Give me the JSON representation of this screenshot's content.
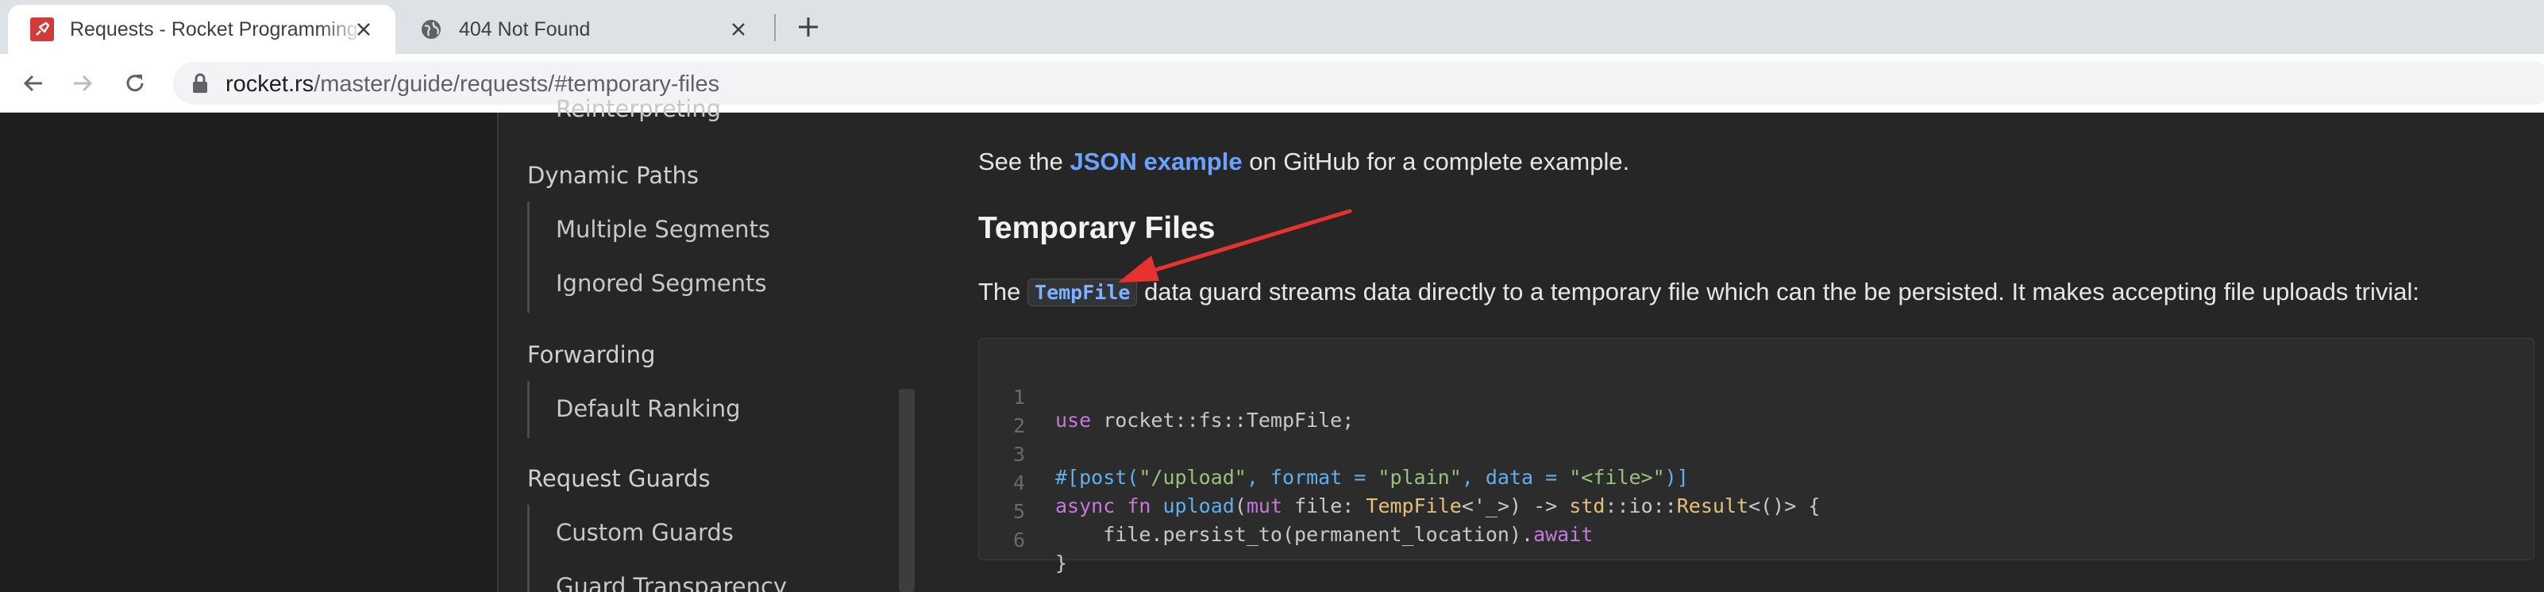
{
  "browser": {
    "tabs": [
      {
        "title": "Requests - Rocket Programming Guide",
        "favicon": "rocket-icon",
        "active": true
      },
      {
        "title": "404 Not Found",
        "favicon": "globe-icon",
        "active": false
      }
    ],
    "url_host": "rocket.rs",
    "url_path": "/master/guide/requests/#temporary-files"
  },
  "sidebar": {
    "cutoff_item": "Reinterpreting",
    "items": [
      {
        "label": "Dynamic Paths",
        "level": 1
      },
      {
        "label": "Multiple Segments",
        "level": 2
      },
      {
        "label": "Ignored Segments",
        "level": 2
      },
      {
        "label": "Forwarding",
        "level": 1
      },
      {
        "label": "Default Ranking",
        "level": 2
      },
      {
        "label": "Request Guards",
        "level": 1
      },
      {
        "label": "Custom Guards",
        "level": 2
      },
      {
        "label": "Guard Transparency",
        "level": 2
      }
    ]
  },
  "content": {
    "intro_before": "See the ",
    "intro_link": "JSON example",
    "intro_after": " on GitHub for a complete example.",
    "heading": "Temporary Files",
    "para_before": "The ",
    "para_code": "TempFile",
    "para_after": " data guard streams data directly to a temporary file which can the be persisted. It makes accepting file uploads trivial:",
    "code_lines": [
      "1",
      "2",
      "3",
      "4",
      "5",
      "6"
    ],
    "code": {
      "l1_kw": "use",
      "l1_rest": " rocket::fs::TempFile;",
      "l3_attr_open": "#[post(",
      "l3_str1": "\"/upload\"",
      "l3_mid1": ", format = ",
      "l3_str2": "\"plain\"",
      "l3_mid2": ", data = ",
      "l3_str3": "\"<file>\"",
      "l3_close": ")]",
      "l4_kw1": "async",
      "l4_kw2": "fn",
      "l4_fn": "upload",
      "l4_p1": "(",
      "l4_kw3": "mut",
      "l4_p2": " file: ",
      "l4_ty1": "TempFile",
      "l4_p3": "<'_>) -> ",
      "l4_ty2": "std",
      "l4_p4": "::io::",
      "l4_ty3": "Result",
      "l4_p5": "<()> {",
      "l5_text": "    file.persist_to(permanent_location).",
      "l5_kw": "await",
      "l6_text": "}"
    }
  },
  "colors": {
    "annotation_arrow": "#e8322f",
    "link": "#6ba1ff"
  }
}
